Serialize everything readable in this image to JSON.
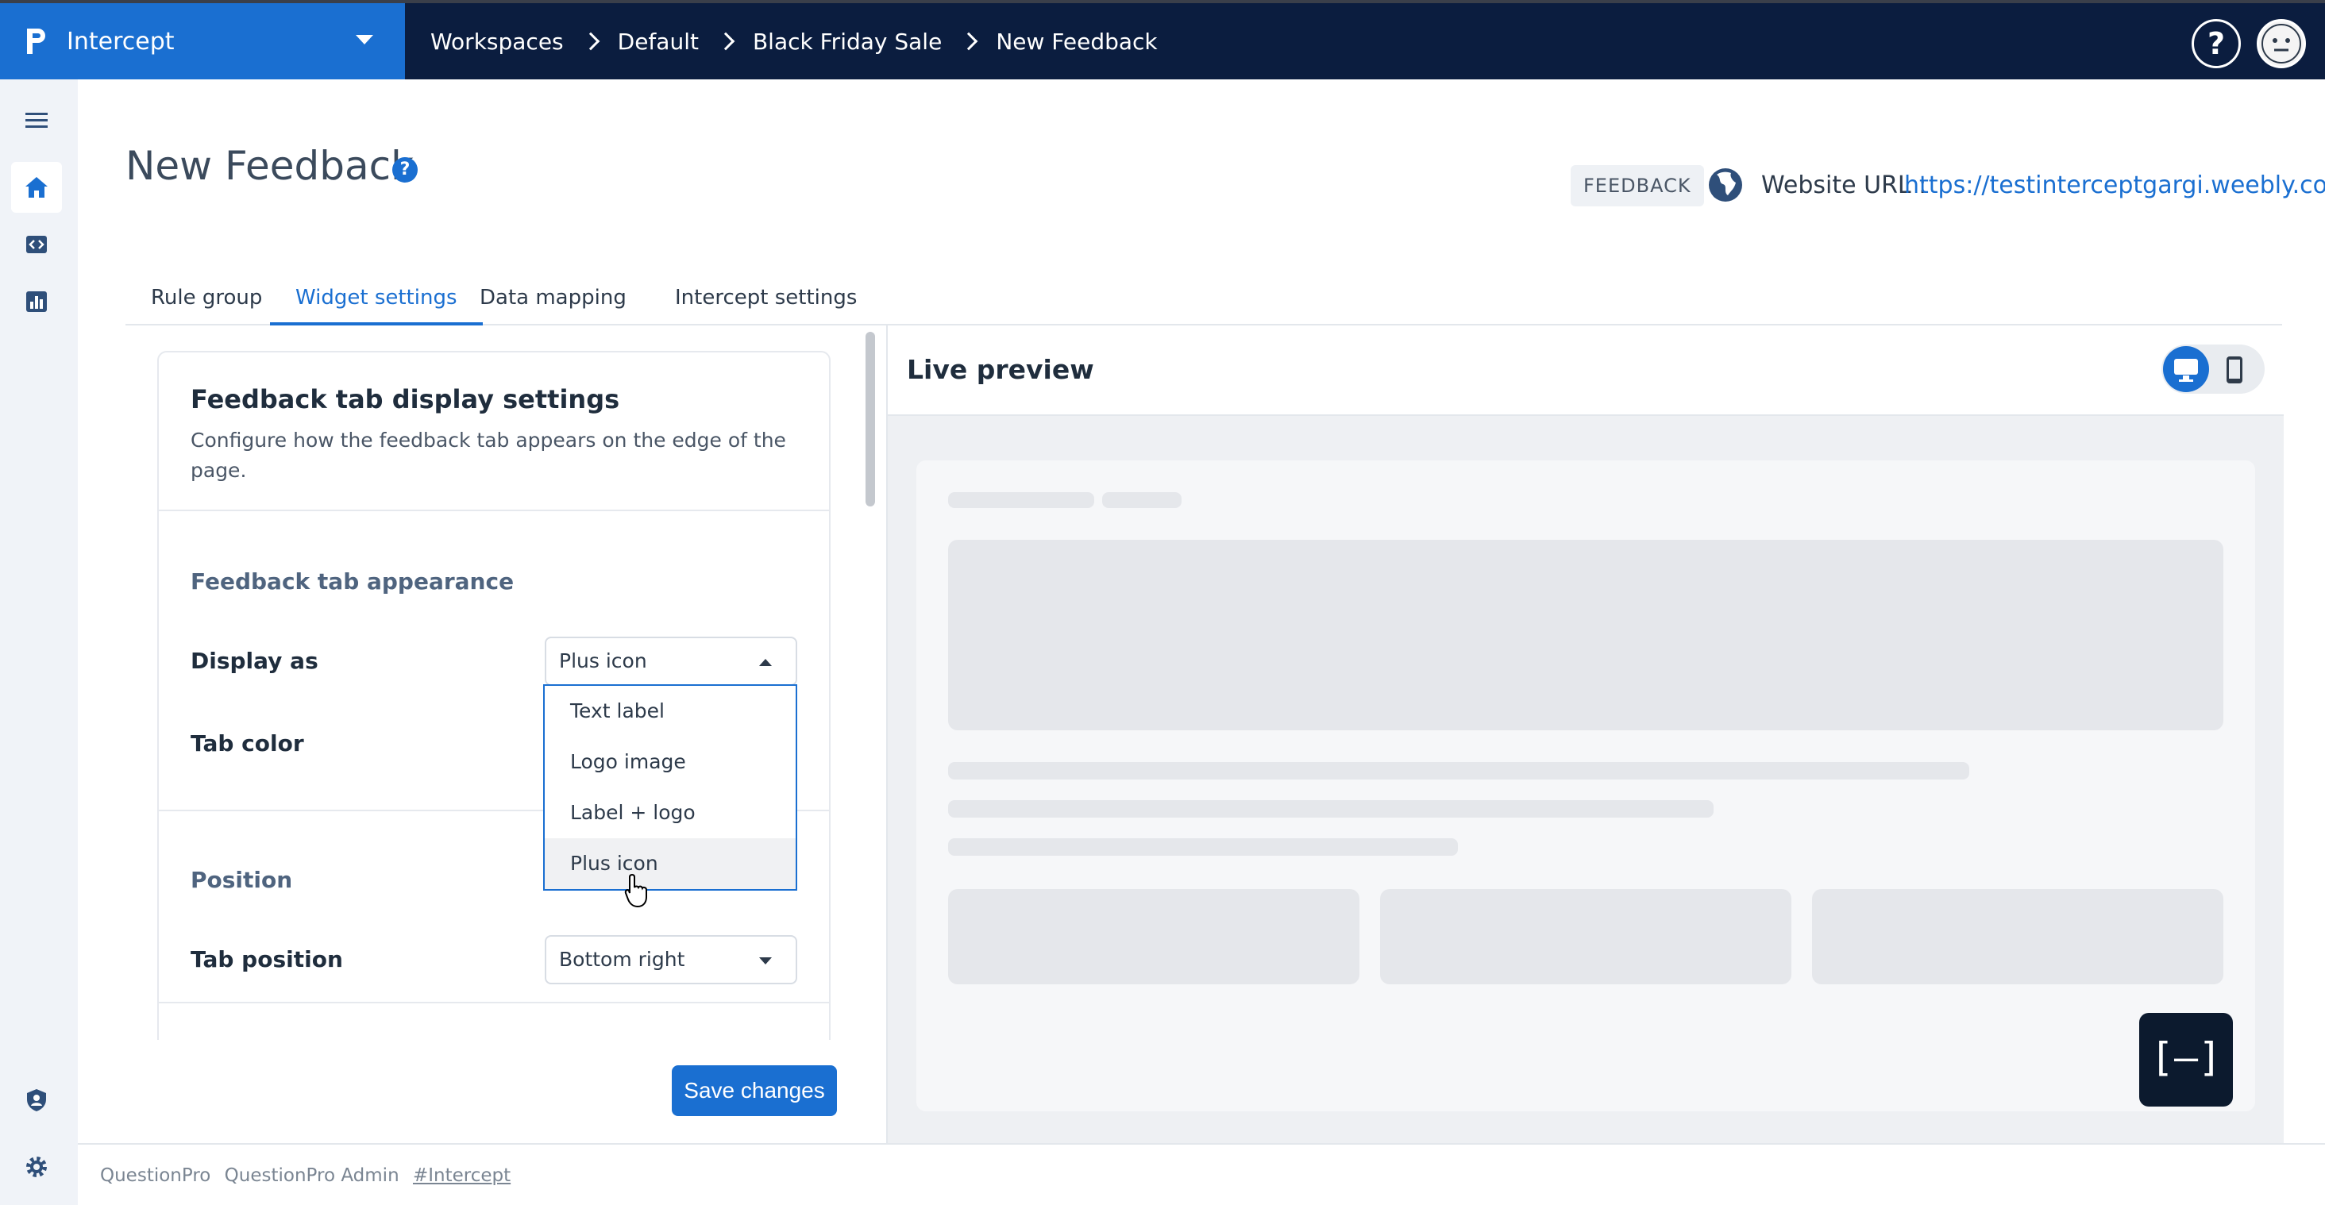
{
  "app": {
    "name": "Intercept",
    "help_symbol": "?"
  },
  "breadcrumbs": [
    "Workspaces",
    "Default",
    "Black Friday Sale",
    "New Feedback"
  ],
  "header": {
    "title": "New Feedback",
    "help_symbol": "?",
    "type_badge": "FEEDBACK",
    "website_label": "Website URL :",
    "website_url": "https://testinterceptgargi.weebly.com"
  },
  "tabs": [
    {
      "label": "Rule group",
      "active": false
    },
    {
      "label": "Widget settings",
      "active": true
    },
    {
      "label": "Data mapping",
      "active": false
    },
    {
      "label": "Intercept settings",
      "active": false
    }
  ],
  "card": {
    "title": "Feedback tab display settings",
    "description": "Configure how the feedback tab appears on the edge of the page.",
    "appearance_section": "Feedback tab appearance",
    "display_as_label": "Display as",
    "display_as_value": "Plus icon",
    "tab_color_label": "Tab color",
    "position_section": "Position",
    "tab_position_label": "Tab position",
    "tab_position_value": "Bottom right"
  },
  "dropdown": {
    "options": [
      "Text label",
      "Logo image",
      "Label + logo",
      "Plus icon"
    ],
    "selected": "Plus icon"
  },
  "save_button": "Save changes",
  "preview": {
    "title": "Live preview",
    "widget_glyph": "[–]"
  },
  "footer": {
    "company": "QuestionPro",
    "user": "QuestionPro Admin",
    "product_link": "#Intercept"
  },
  "colors": {
    "topbar": "#0b1d3f",
    "brand": "#1a6fd1",
    "accent": "#1a6fd1",
    "widget": "#0c1a2e"
  }
}
